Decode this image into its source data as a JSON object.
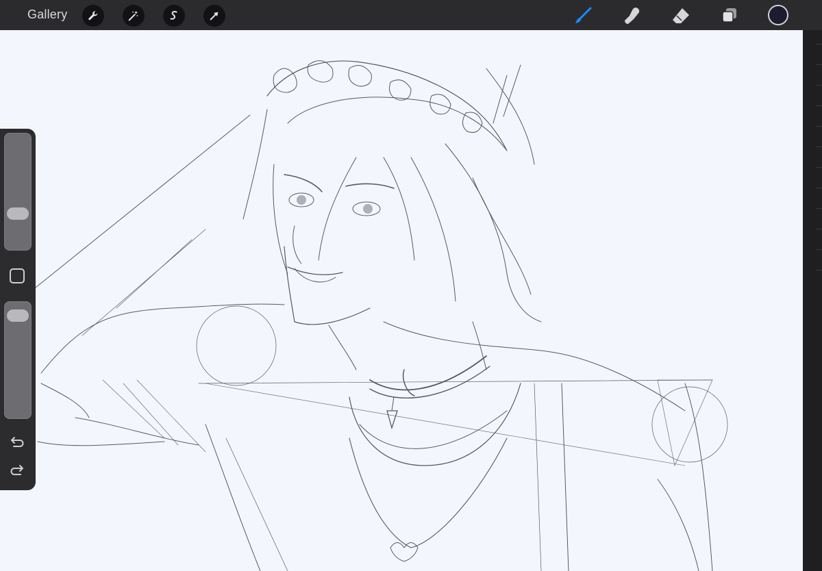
{
  "toolbar": {
    "gallery_label": "Gallery",
    "left_tools": [
      {
        "name": "actions",
        "icon": "wrench-icon"
      },
      {
        "name": "adjustments",
        "icon": "magic-wand-icon"
      },
      {
        "name": "selection",
        "icon": "selection-s-icon"
      },
      {
        "name": "transform",
        "icon": "arrow-cursor-icon"
      }
    ],
    "right_tools": [
      {
        "name": "brush",
        "icon": "brush-icon",
        "active": true
      },
      {
        "name": "smudge",
        "icon": "smudge-icon"
      },
      {
        "name": "eraser",
        "icon": "eraser-icon"
      },
      {
        "name": "layers",
        "icon": "layers-icon"
      }
    ],
    "current_color": "#1c1c2e",
    "active_color": "#1a8cff"
  },
  "sidebar": {
    "brush_size_level": 0.28,
    "opacity_level": 0.95,
    "modify_button": "square-modify-icon",
    "undo": "undo-icon",
    "redo": "redo-icon"
  },
  "canvas": {
    "background": "#f3f7fd",
    "content": "pencil-sketch-artwork"
  }
}
